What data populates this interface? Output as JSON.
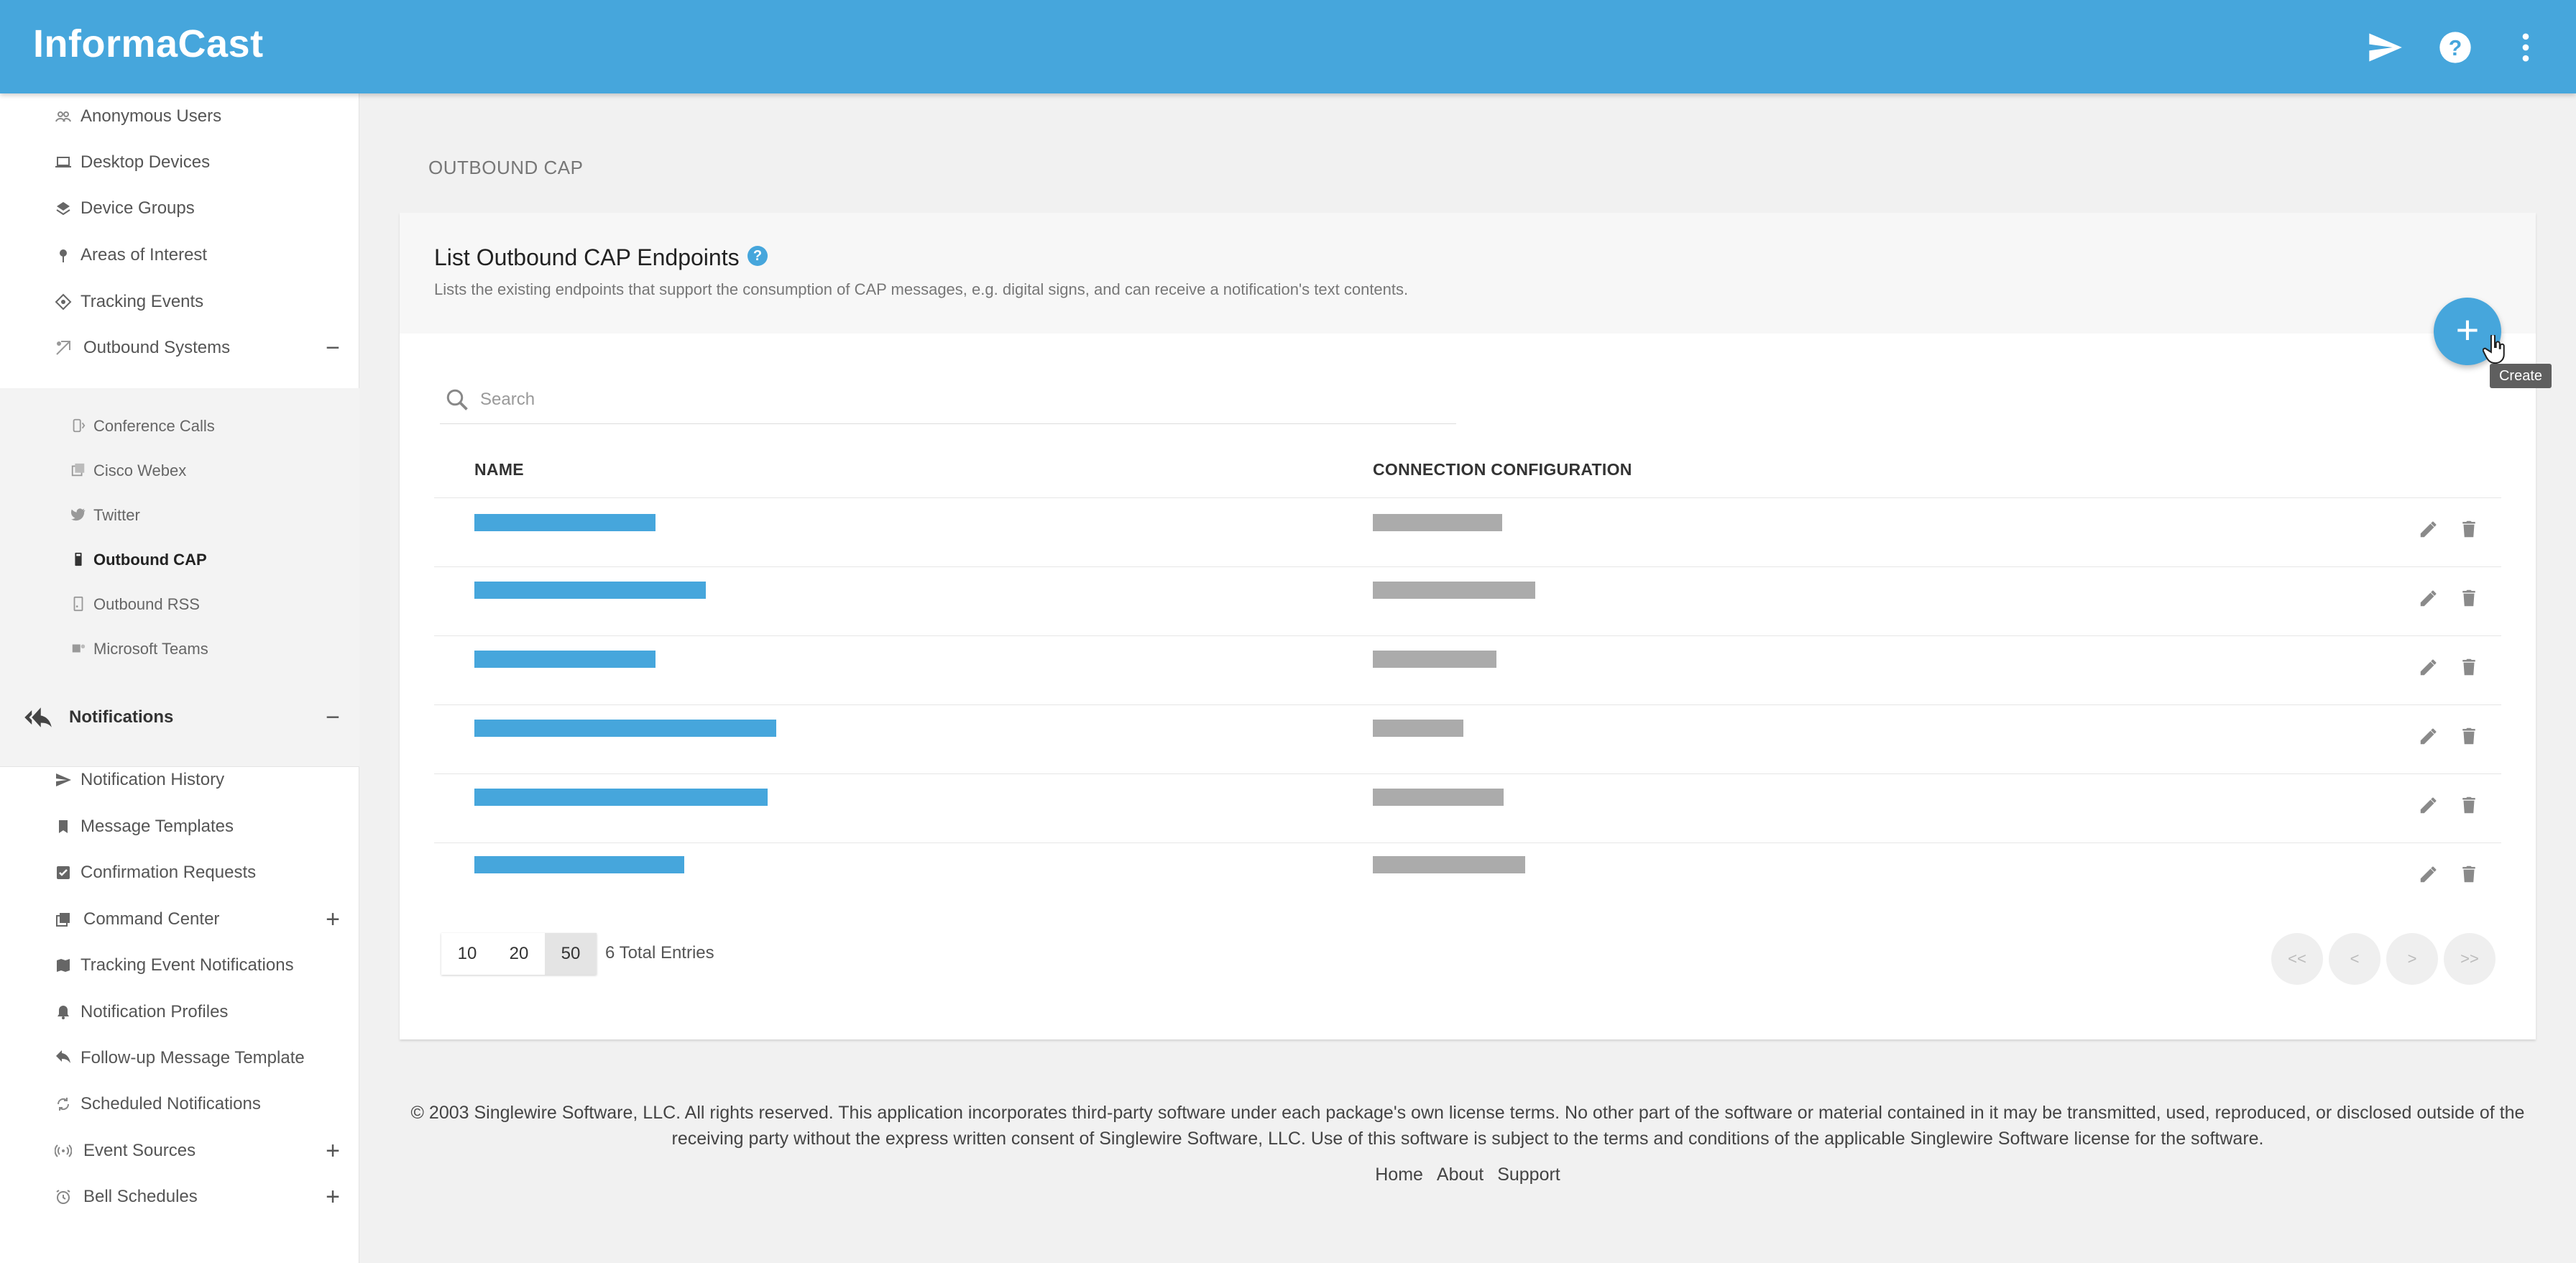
{
  "header": {
    "app_title": "InformaCast",
    "icons": [
      "send-icon",
      "help-icon",
      "more-vert-icon"
    ]
  },
  "sidebar": {
    "top_items": [
      {
        "label": "Anonymous Users",
        "icon": "users-icon"
      },
      {
        "label": "Desktop Devices",
        "icon": "laptop-icon"
      },
      {
        "label": "Device Groups",
        "icon": "layers-icon"
      },
      {
        "label": "Areas of Interest",
        "icon": "pin-icon"
      },
      {
        "label": "Tracking Events",
        "icon": "target-icon"
      },
      {
        "label": "Outbound Systems",
        "icon": "outbound-icon",
        "toggle": "−"
      }
    ],
    "sub_items": [
      {
        "label": "Conference Calls",
        "icon": "phone-icon"
      },
      {
        "label": "Cisco Webex",
        "icon": "webex-icon"
      },
      {
        "label": "Twitter",
        "icon": "twitter-icon"
      },
      {
        "label": "Outbound CAP",
        "icon": "cap-icon",
        "active": true
      },
      {
        "label": "Outbound RSS",
        "icon": "rss-icon"
      },
      {
        "label": "Microsoft Teams",
        "icon": "teams-icon"
      }
    ],
    "notifications": {
      "label": "Notifications",
      "icon": "reply-all-icon",
      "toggle": "−"
    },
    "notification_items": [
      {
        "label": "Notification History",
        "icon": "send-icon"
      },
      {
        "label": "Message Templates",
        "icon": "bookmark-icon"
      },
      {
        "label": "Confirmation Requests",
        "icon": "checkbox-icon"
      },
      {
        "label": "Command Center",
        "icon": "library-icon",
        "toggle": "+"
      },
      {
        "label": "Tracking Event Notifications",
        "icon": "map-icon"
      },
      {
        "label": "Notification Profiles",
        "icon": "bell-icon"
      },
      {
        "label": "Follow-up Message Template",
        "icon": "reply-icon"
      },
      {
        "label": "Scheduled Notifications",
        "icon": "repeat-icon"
      },
      {
        "label": "Event Sources",
        "icon": "broadcast-icon",
        "toggle": "+"
      },
      {
        "label": "Bell Schedules",
        "icon": "alarm-icon",
        "toggle": "+"
      }
    ]
  },
  "page": {
    "breadcrumb": "OUTBOUND CAP",
    "title": "List Outbound CAP Endpoints",
    "help": "?",
    "description": "Lists the existing endpoints that support the consumption of CAP messages, e.g. digital signs, and can receive a notification's text contents.",
    "create_symbol": "+",
    "create_tooltip": "Create",
    "search_placeholder": "Search",
    "columns": {
      "name": "NAME",
      "connection": "CONNECTION CONFIGURATION"
    }
  },
  "pagination": {
    "page_sizes": [
      "10",
      "20",
      "50"
    ],
    "selected_size": "50",
    "total_entries": "6 Total Entries",
    "nav": [
      "<<",
      "<",
      ">",
      ">>"
    ]
  },
  "footer": {
    "copyright": "© 2003 Singlewire Software, LLC. All rights reserved. This application incorporates third-party software under each package's own license terms. No other part of the software or material contained in it may be transmitted, used, reproduced, or disclosed outside of the receiving party without the express written consent of Singlewire Software, LLC. Use of this software is subject to the terms and conditions of the applicable Singlewire Software license for the software.",
    "links": [
      "Home",
      "About",
      "Support"
    ]
  },
  "colors": {
    "brand": "#46a6dc",
    "redacted_name": "#46a6dc",
    "redacted_config": "#ababab"
  }
}
